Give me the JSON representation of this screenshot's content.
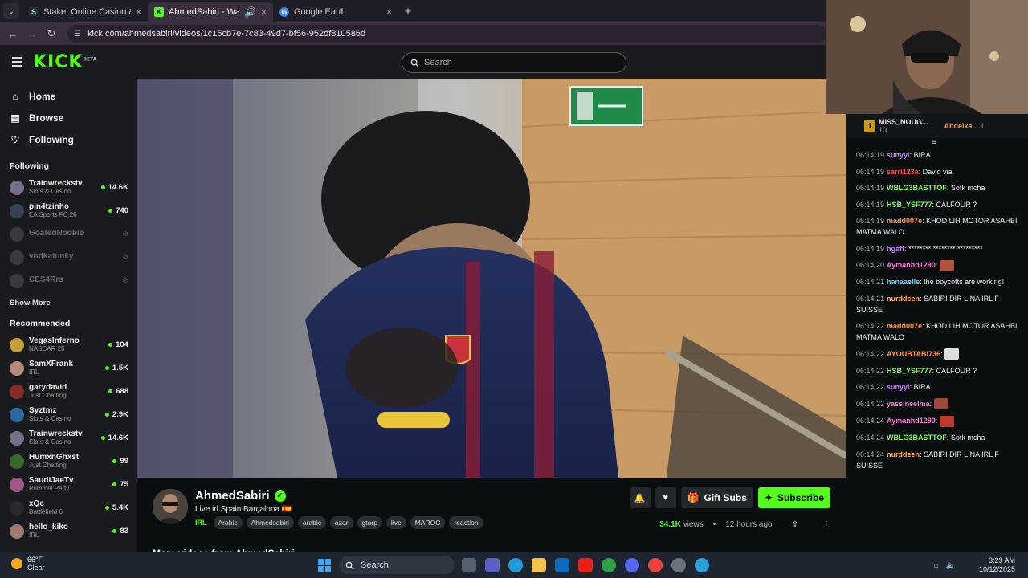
{
  "browser": {
    "tabs": [
      {
        "title": "Stake: Online Casino & Sports",
        "favicon": "S",
        "color": "#1a2c38"
      },
      {
        "title": "AhmedSabiri - Watch the V",
        "favicon": "K",
        "color": "#53fc18",
        "active": true
      },
      {
        "title": "Google Earth",
        "favicon": "G",
        "color": "#4285f4"
      }
    ],
    "url": "kick.com/ahmedsabiri/videos/1c15cb7e-7c83-49d7-bf56-952df810586d"
  },
  "header": {
    "logo": "KICK",
    "logo_badge": "BETA",
    "search_placeholder": "Search"
  },
  "sidebar": {
    "nav": [
      {
        "label": "Home",
        "icon": "home-icon"
      },
      {
        "label": "Browse",
        "icon": "browse-icon"
      },
      {
        "label": "Following",
        "icon": "heart-icon"
      }
    ],
    "following_title": "Following",
    "following": [
      {
        "name": "Trainwreckstv",
        "category": "Slots & Casino",
        "viewers": "14.6K",
        "live": true,
        "avatar": "#7a6f8a"
      },
      {
        "name": "pin4tzinho",
        "category": "EA Sports FC 26",
        "viewers": "740",
        "live": true,
        "avatar": "#334455"
      },
      {
        "name": "GoatedNoobie",
        "category": "",
        "viewers": "",
        "live": false,
        "avatar": "#6a6a6a"
      },
      {
        "name": "vodkafunky",
        "category": "",
        "viewers": "",
        "live": false,
        "avatar": "#6a6a6a"
      },
      {
        "name": "CES4Rrs",
        "category": "",
        "viewers": "",
        "live": false,
        "avatar": "#6a6a6a"
      }
    ],
    "show_more": "Show More",
    "recommended_title": "Recommended",
    "recommended": [
      {
        "name": "VegasInferno",
        "category": "NASCAR 25",
        "viewers": "104",
        "avatar": "#c4a13a"
      },
      {
        "name": "SamXFrank",
        "category": "IRL",
        "viewers": "1.5K",
        "avatar": "#b58a7a"
      },
      {
        "name": "garydavid",
        "category": "Just Chatting",
        "viewers": "688",
        "avatar": "#8a2b2b"
      },
      {
        "name": "Syztmz",
        "category": "Slots & Casino",
        "viewers": "2.9K",
        "avatar": "#2a6aa0"
      },
      {
        "name": "Trainwreckstv",
        "category": "Slots & Casino",
        "viewers": "14.6K",
        "avatar": "#7a6f8a"
      },
      {
        "name": "HumxnGhxst",
        "category": "Just Chatting",
        "viewers": "99",
        "avatar": "#3a6a2a"
      },
      {
        "name": "SaudiJaeTv",
        "category": "Pummel Party",
        "viewers": "75",
        "avatar": "#a05a8a"
      },
      {
        "name": "xQc",
        "category": "Battlefield 6",
        "viewers": "5.4K",
        "avatar": "#2a2a2a"
      },
      {
        "name": "hello_kiko",
        "category": "IRL",
        "viewers": "83",
        "avatar": "#a07a6a"
      }
    ]
  },
  "video_info": {
    "username": "AhmedSabiri",
    "title": "Live irl Spain Barçalona 🇪🇸",
    "category": "IRL",
    "tags": [
      "Arabic",
      "Ahmedsabiri",
      "arabic",
      "azar",
      "gtarp",
      "live",
      "MAROC",
      "reaction"
    ],
    "gift_label": "Gift Subs",
    "subscribe_label": "Subscribe",
    "views_count": "34.1K",
    "views_word": "views",
    "time_ago": "12 hours ago",
    "more_videos": "More videos from AhmedSabiri"
  },
  "chat": {
    "leaderboard": [
      {
        "rank": "1",
        "name": "MISS_NOUG...",
        "count": "10"
      },
      {
        "rank": "",
        "name": "Abdelka...",
        "count": "1"
      }
    ],
    "messages": [
      {
        "time": "06:14:19",
        "user": "sunyyl",
        "color": "#c77dff",
        "text": "BIRA"
      },
      {
        "time": "06:14:19",
        "user": "sarri123a",
        "color": "#ff4d4d",
        "text": "David via"
      },
      {
        "time": "06:14:19",
        "user": "WBLG3BASTTOF",
        "color": "#7dff5a",
        "text": "Sotk mcha"
      },
      {
        "time": "06:14:19",
        "user": "HSB_YSF777",
        "color": "#7dff5a",
        "text": "CALFOUR ?"
      },
      {
        "time": "06:14:19",
        "user": "madd007e",
        "color": "#ff9a4d",
        "text": "KHOD LIH MOTOR ASAHBI MATMA WALO"
      },
      {
        "time": "06:14:19",
        "user": "hgaft",
        "color": "#c77dff",
        "text": "******** ******** *********"
      },
      {
        "time": "06:14:20",
        "user": "Aymanhd1290",
        "color": "#ff7ad9",
        "text": "",
        "emote": "#b0533c"
      },
      {
        "time": "06:14:21",
        "user": "hanaaelle",
        "color": "#5ad7ff",
        "text": "the boycotts are working!"
      },
      {
        "time": "06:14:21",
        "user": "nurddeen",
        "color": "#ffb35a",
        "text": "SABIRI DIR LINA IRL F SUISSE"
      },
      {
        "time": "06:14:22",
        "user": "madd007e",
        "color": "#ff9a4d",
        "text": "KHOD LIH MOTOR ASAHBI MATMA WALO"
      },
      {
        "time": "06:14:22",
        "user": "AYOUBTABI736",
        "color": "#ff9a4d",
        "text": "",
        "emote": "#dddddd"
      },
      {
        "time": "06:14:22",
        "user": "HSB_YSF777",
        "color": "#7dff5a",
        "text": "CALFOUR ?"
      },
      {
        "time": "06:14:22",
        "user": "sunyyl",
        "color": "#c77dff",
        "text": "BIRA"
      },
      {
        "time": "06:14:22",
        "user": "yassineelma",
        "color": "#ff7ad9",
        "text": "",
        "emote": "#9c4a3a"
      },
      {
        "time": "06:14:24",
        "user": "Aymanhd1290",
        "color": "#ff7ad9",
        "text": "",
        "emote": "#c0392b"
      },
      {
        "time": "06:14:24",
        "user": "WBLG3BASTTOF",
        "color": "#7dff5a",
        "text": "Sotk mcha"
      },
      {
        "time": "06:14:24",
        "user": "nurddeen",
        "color": "#ffb35a",
        "text": "SABIRI DIR LINA IRL F SUISSE"
      }
    ]
  },
  "taskbar": {
    "temp": "66°F",
    "weather": "Clear",
    "search": "Search",
    "time": "3:29 AM",
    "date": "10/12/2025"
  }
}
